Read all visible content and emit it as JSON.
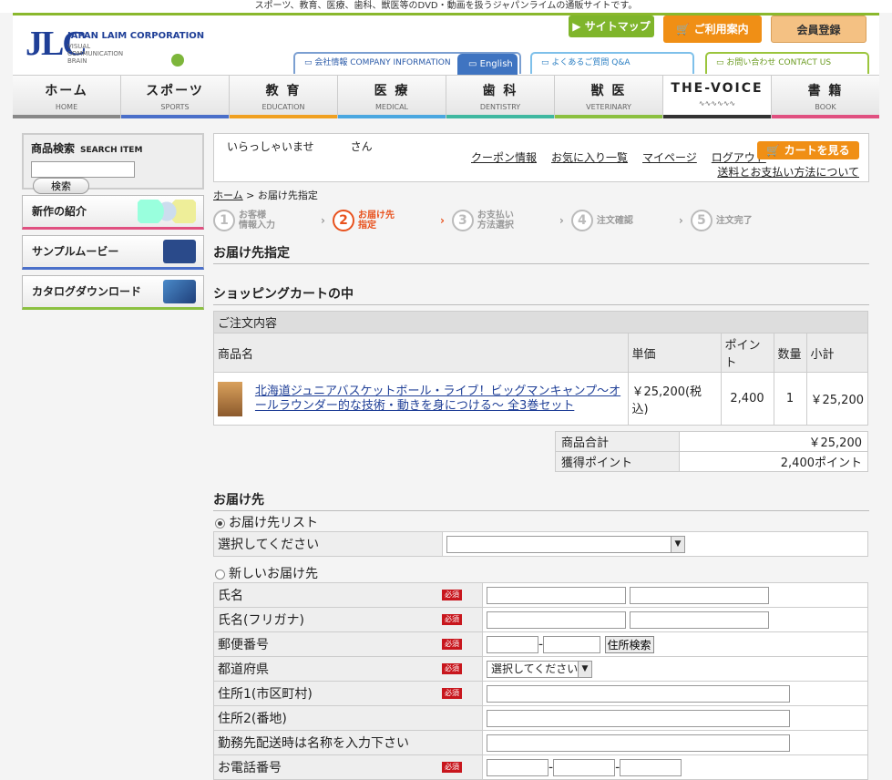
{
  "topbar_text": "スポーツ、教育、医療、歯科、獣医等のDVD・動画を扱うジャパンライムの通販サイトです。",
  "logo": {
    "mark": "JLC",
    "corp": "JAPAN LAIM CORPORATION",
    "sub1": "VISUAL",
    "sub2": "COMMUNICATION",
    "sub3": "BRAIN"
  },
  "header_buttons": {
    "sitemap": "サイトマップ",
    "guide": "ご利用案内",
    "member": "会員登録"
  },
  "header_tabs": {
    "company": "会社情報  COMPANY INFORMATION",
    "english": "English",
    "faq": "よくあるご質問  Q&A",
    "contact": "お問い合わせ  CONTACT US"
  },
  "nav": [
    {
      "jp": "ホーム",
      "en": "HOME",
      "color": "#888888"
    },
    {
      "jp": "スポーツ",
      "en": "SPORTS",
      "color": "#4a6fc9"
    },
    {
      "jp": "教 育",
      "en": "EDUCATION",
      "color": "#f0a020"
    },
    {
      "jp": "医 療",
      "en": "MEDICAL",
      "color": "#4aa7e0"
    },
    {
      "jp": "歯 科",
      "en": "DENTISTRY",
      "color": "#3fb8a0"
    },
    {
      "jp": "獣 医",
      "en": "VETERINARY",
      "color": "#8bc040"
    },
    {
      "jp": "THE-VOICE",
      "en": "",
      "color": "#333333"
    },
    {
      "jp": "書 籍",
      "en": "BOOK",
      "color": "#e05080"
    }
  ],
  "sidebar": {
    "search_title": "商品検索",
    "search_title_en": "SEARCH ITEM",
    "search_button": "検索",
    "items": [
      "新作の紹介",
      "サンプルムービー",
      "カタログダウンロード"
    ]
  },
  "welcome": {
    "greet_pre": "いらっしゃいませ",
    "greet_post": "さん",
    "links": [
      "クーポン情報",
      "お気に入り一覧",
      "マイページ",
      "ログアウト"
    ],
    "cart_button": "カートを見る",
    "pay_link": "送料とお支払い方法について"
  },
  "breadcrumb": {
    "home": "ホーム",
    "current": "お届け先指定"
  },
  "steps": [
    {
      "num": "1",
      "l1": "お客様",
      "l2": "情報入力"
    },
    {
      "num": "2",
      "l1": "お届け先",
      "l2": "指定"
    },
    {
      "num": "3",
      "l1": "お支払い",
      "l2": "方法選択"
    },
    {
      "num": "4",
      "l1": "注文確認",
      "l2": ""
    },
    {
      "num": "5",
      "l1": "注文完了",
      "l2": ""
    }
  ],
  "page_title": "お届け先指定",
  "cart_title": "ショッピングカートの中",
  "cart": {
    "head": "ご注文内容",
    "cols": [
      "商品名",
      "単価",
      "ポイント",
      "数量",
      "小計"
    ],
    "item": {
      "name": "北海道ジュニアバスケットボール・ライブ！ビッグマンキャンプ～オールラウンダー的な技術・動きを身につける～ 全3巻セット",
      "price": "￥25,200(税込)",
      "points": "2,400",
      "qty": "1",
      "subtotal": "￥25,200"
    },
    "total_label": "商品合計",
    "total_value": "￥25,200",
    "points_label": "獲得ポイント",
    "points_value": "2,400ポイント"
  },
  "ship_title": "お届け先",
  "ship_list_label": "お届け先リスト",
  "ship_list_row": "選択してください",
  "new_ship_label": "新しいお届け先",
  "required": "必須",
  "form_rows": [
    "氏名",
    "氏名(フリガナ)",
    "郵便番号",
    "都道府県",
    "住所1(市区町村)",
    "住所2(番地)",
    "勤務先配送時は名称を入力下さい",
    "お電話番号"
  ],
  "zip_button": "住所検索",
  "pref_select": "選択してください"
}
